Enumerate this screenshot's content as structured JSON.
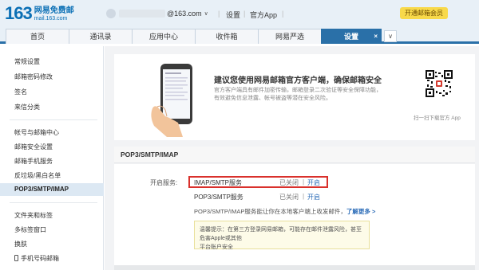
{
  "app": {
    "logo_number": "163",
    "logo_name": "网易免费邮",
    "logo_domain": "mail.163.com"
  },
  "user": {
    "email_suffix": "@163.com",
    "caret": "∨"
  },
  "top_links": {
    "settings": "设置",
    "official_app": "官方App",
    "vip_button": "开通邮箱会员"
  },
  "tabs": [
    {
      "label": "首页"
    },
    {
      "label": "通讯录"
    },
    {
      "label": "应用中心"
    },
    {
      "label": "收件箱"
    },
    {
      "label": "网易严选"
    },
    {
      "label": "设置",
      "active": true
    }
  ],
  "tab_more": "∨",
  "sidebar": {
    "items": [
      {
        "label": "常规设置"
      },
      {
        "label": "邮箱密码修改"
      },
      {
        "label": "签名"
      },
      {
        "label": "来信分类"
      },
      {
        "label": "帐号与邮箱中心"
      },
      {
        "label": "邮箱安全设置"
      },
      {
        "label": "邮箱手机服务"
      },
      {
        "label": "反垃圾/黑白名单"
      },
      {
        "label": "POP3/SMTP/IMAP",
        "active": true
      },
      {
        "label": "文件夹和标签"
      },
      {
        "label": "多标签窗口"
      },
      {
        "label": "换肤"
      },
      {
        "label": "手机号码邮箱",
        "icon": "phone-icon"
      }
    ]
  },
  "banner": {
    "title": "建议您使用网易邮箱官方客户端，确保邮箱安全",
    "desc": "官方客户端具有邮件加密传输，邮箱登录二次验证等安全保障功能，有效避免信息泄露、帐号被盗等潜在安全风险。",
    "qr_caption": "扫一扫下载官方 App"
  },
  "section": {
    "title": "POP3/SMTP/IMAP",
    "open_label": "开启服务:",
    "services": [
      {
        "name": "IMAP/SMTP服务",
        "status": "已关闭",
        "sep": "|",
        "action": "开启"
      },
      {
        "name": "POP3/SMTP服务",
        "status": "已关闭",
        "sep": "|",
        "action": "开启"
      }
    ],
    "info_text": "POP3/SMTP/IMAP服务能让你在本地客户端上收发邮件，",
    "info_link": "了解更多 >",
    "tip_line1": "温馨提示：在第三方登录网易邮箱，可能存在邮件泄露风险，甚至危害Apple或其他",
    "tip_line2": "平台账户安全"
  },
  "colors": {
    "brand_blue": "#2a70a8",
    "highlight_red": "#d9312c",
    "link_blue": "#2a6bb7",
    "vip_yellow": "#f8d94a"
  }
}
